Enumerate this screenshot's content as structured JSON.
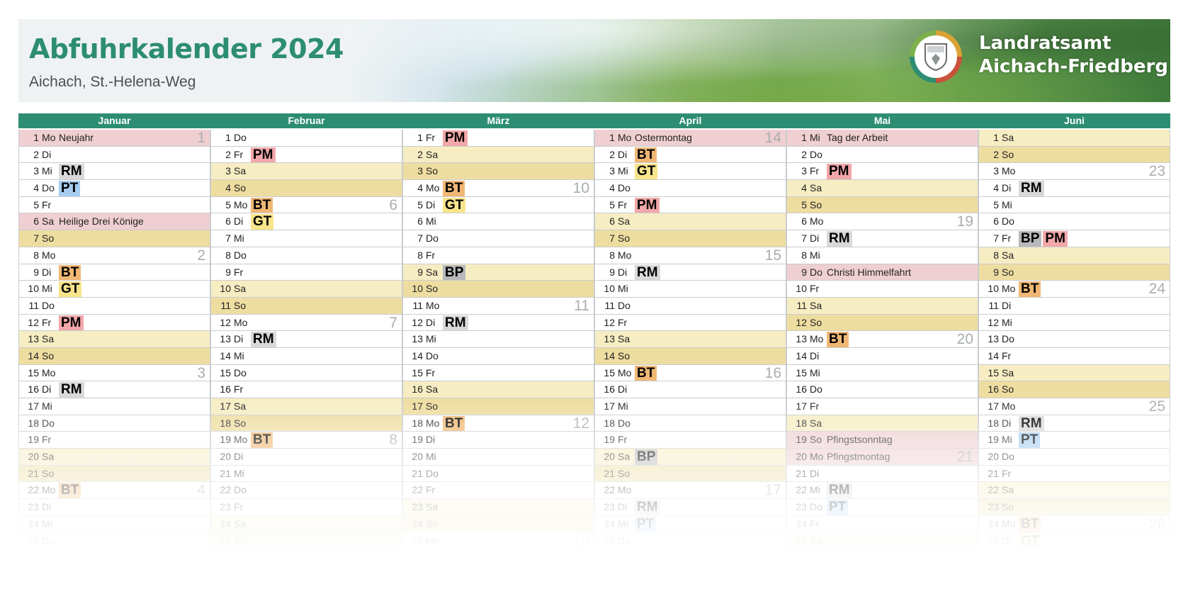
{
  "header": {
    "title": "Abfuhrkalender 2024",
    "subtitle": "Aichach, St.-Helena-Weg",
    "org_line1": "Landratsamt",
    "org_line2": "Aichach-Friedberg",
    "logo_icon": "coat-of-arms-icon"
  },
  "colors": {
    "accent": "#2d8d72",
    "saturday": "#f6edc3",
    "sunday": "#eedda0",
    "holiday": "#efcfd1",
    "RM": "#d9d9d9",
    "PT": "#a6cdf0",
    "PM": "#f2a7a9",
    "BT": "#f0b774",
    "GT": "#f8e48a",
    "BP": "#b7b8ba"
  },
  "months": [
    {
      "name": "Januar",
      "days": [
        {
          "d": "1",
          "wd": "Mo",
          "hol": "Neujahr",
          "kw": "1"
        },
        {
          "d": "2",
          "wd": "Di"
        },
        {
          "d": "3",
          "wd": "Mi",
          "badges": [
            "RM"
          ]
        },
        {
          "d": "4",
          "wd": "Do",
          "badges": [
            "PT"
          ]
        },
        {
          "d": "5",
          "wd": "Fr"
        },
        {
          "d": "6",
          "wd": "Sa",
          "hol": "Heilige Drei Könige"
        },
        {
          "d": "7",
          "wd": "So"
        },
        {
          "d": "8",
          "wd": "Mo",
          "kw": "2"
        },
        {
          "d": "9",
          "wd": "Di",
          "badges": [
            "BT"
          ]
        },
        {
          "d": "10",
          "wd": "Mi",
          "badges": [
            "GT"
          ]
        },
        {
          "d": "11",
          "wd": "Do"
        },
        {
          "d": "12",
          "wd": "Fr",
          "badges": [
            "PM"
          ]
        },
        {
          "d": "13",
          "wd": "Sa"
        },
        {
          "d": "14",
          "wd": "So"
        },
        {
          "d": "15",
          "wd": "Mo",
          "kw": "3"
        },
        {
          "d": "16",
          "wd": "Di",
          "badges": [
            "RM"
          ]
        },
        {
          "d": "17",
          "wd": "Mi"
        },
        {
          "d": "18",
          "wd": "Do"
        },
        {
          "d": "19",
          "wd": "Fr"
        },
        {
          "d": "20",
          "wd": "Sa"
        },
        {
          "d": "21",
          "wd": "So"
        },
        {
          "d": "22",
          "wd": "Mo",
          "badges": [
            "BT"
          ],
          "kw": "4"
        },
        {
          "d": "23",
          "wd": "Di"
        },
        {
          "d": "24",
          "wd": "Mi"
        },
        {
          "d": "25",
          "wd": "Do"
        }
      ]
    },
    {
      "name": "Februar",
      "days": [
        {
          "d": "1",
          "wd": "Do"
        },
        {
          "d": "2",
          "wd": "Fr",
          "badges": [
            "PM"
          ]
        },
        {
          "d": "3",
          "wd": "Sa"
        },
        {
          "d": "4",
          "wd": "So"
        },
        {
          "d": "5",
          "wd": "Mo",
          "badges": [
            "BT"
          ],
          "kw": "6"
        },
        {
          "d": "6",
          "wd": "Di",
          "badges": [
            "GT"
          ]
        },
        {
          "d": "7",
          "wd": "Mi"
        },
        {
          "d": "8",
          "wd": "Do"
        },
        {
          "d": "9",
          "wd": "Fr"
        },
        {
          "d": "10",
          "wd": "Sa"
        },
        {
          "d": "11",
          "wd": "So"
        },
        {
          "d": "12",
          "wd": "Mo",
          "kw": "7"
        },
        {
          "d": "13",
          "wd": "Di",
          "badges": [
            "RM"
          ]
        },
        {
          "d": "14",
          "wd": "Mi"
        },
        {
          "d": "15",
          "wd": "Do"
        },
        {
          "d": "16",
          "wd": "Fr"
        },
        {
          "d": "17",
          "wd": "Sa"
        },
        {
          "d": "18",
          "wd": "So"
        },
        {
          "d": "19",
          "wd": "Mo",
          "badges": [
            "BT"
          ],
          "kw": "8"
        },
        {
          "d": "20",
          "wd": "Di"
        },
        {
          "d": "21",
          "wd": "Mi"
        },
        {
          "d": "22",
          "wd": "Do"
        },
        {
          "d": "23",
          "wd": "Fr"
        },
        {
          "d": "24",
          "wd": "Sa"
        },
        {
          "d": "25",
          "wd": "So"
        }
      ]
    },
    {
      "name": "März",
      "days": [
        {
          "d": "1",
          "wd": "Fr",
          "badges": [
            "PM"
          ]
        },
        {
          "d": "2",
          "wd": "Sa"
        },
        {
          "d": "3",
          "wd": "So"
        },
        {
          "d": "4",
          "wd": "Mo",
          "badges": [
            "BT"
          ],
          "kw": "10"
        },
        {
          "d": "5",
          "wd": "Di",
          "badges": [
            "GT"
          ]
        },
        {
          "d": "6",
          "wd": "Mi"
        },
        {
          "d": "7",
          "wd": "Do"
        },
        {
          "d": "8",
          "wd": "Fr"
        },
        {
          "d": "9",
          "wd": "Sa",
          "badges": [
            "BP"
          ]
        },
        {
          "d": "10",
          "wd": "So"
        },
        {
          "d": "11",
          "wd": "Mo",
          "kw": "11"
        },
        {
          "d": "12",
          "wd": "Di",
          "badges": [
            "RM"
          ]
        },
        {
          "d": "13",
          "wd": "Mi"
        },
        {
          "d": "14",
          "wd": "Do"
        },
        {
          "d": "15",
          "wd": "Fr"
        },
        {
          "d": "16",
          "wd": "Sa"
        },
        {
          "d": "17",
          "wd": "So"
        },
        {
          "d": "18",
          "wd": "Mo",
          "badges": [
            "BT"
          ],
          "kw": "12"
        },
        {
          "d": "19",
          "wd": "Di"
        },
        {
          "d": "20",
          "wd": "Mi"
        },
        {
          "d": "21",
          "wd": "Do"
        },
        {
          "d": "22",
          "wd": "Fr"
        },
        {
          "d": "23",
          "wd": "Sa"
        },
        {
          "d": "24",
          "wd": "So"
        },
        {
          "d": "25",
          "wd": "Mo",
          "kw": "13"
        }
      ]
    },
    {
      "name": "April",
      "days": [
        {
          "d": "1",
          "wd": "Mo",
          "hol": "Ostermontag",
          "kw": "14"
        },
        {
          "d": "2",
          "wd": "Di",
          "badges": [
            "BT"
          ]
        },
        {
          "d": "3",
          "wd": "Mi",
          "badges": [
            "GT"
          ]
        },
        {
          "d": "4",
          "wd": "Do"
        },
        {
          "d": "5",
          "wd": "Fr",
          "badges": [
            "PM"
          ]
        },
        {
          "d": "6",
          "wd": "Sa"
        },
        {
          "d": "7",
          "wd": "So"
        },
        {
          "d": "8",
          "wd": "Mo",
          "kw": "15"
        },
        {
          "d": "9",
          "wd": "Di",
          "badges": [
            "RM"
          ]
        },
        {
          "d": "10",
          "wd": "Mi"
        },
        {
          "d": "11",
          "wd": "Do"
        },
        {
          "d": "12",
          "wd": "Fr"
        },
        {
          "d": "13",
          "wd": "Sa"
        },
        {
          "d": "14",
          "wd": "So"
        },
        {
          "d": "15",
          "wd": "Mo",
          "badges": [
            "BT"
          ],
          "kw": "16"
        },
        {
          "d": "16",
          "wd": "Di"
        },
        {
          "d": "17",
          "wd": "Mi"
        },
        {
          "d": "18",
          "wd": "Do"
        },
        {
          "d": "19",
          "wd": "Fr"
        },
        {
          "d": "20",
          "wd": "Sa",
          "badges": [
            "BP"
          ]
        },
        {
          "d": "21",
          "wd": "So"
        },
        {
          "d": "22",
          "wd": "Mo",
          "kw": "17"
        },
        {
          "d": "23",
          "wd": "Di",
          "badges": [
            "RM"
          ]
        },
        {
          "d": "24",
          "wd": "Mi",
          "badges": [
            "PT"
          ]
        },
        {
          "d": "25",
          "wd": "Do"
        }
      ]
    },
    {
      "name": "Mai",
      "days": [
        {
          "d": "1",
          "wd": "Mi",
          "hol": "Tag der Arbeit"
        },
        {
          "d": "2",
          "wd": "Do"
        },
        {
          "d": "3",
          "wd": "Fr",
          "badges": [
            "PM"
          ]
        },
        {
          "d": "4",
          "wd": "Sa"
        },
        {
          "d": "5",
          "wd": "So"
        },
        {
          "d": "6",
          "wd": "Mo",
          "kw": "19"
        },
        {
          "d": "7",
          "wd": "Di",
          "badges": [
            "RM"
          ]
        },
        {
          "d": "8",
          "wd": "Mi"
        },
        {
          "d": "9",
          "wd": "Do",
          "hol": "Christi Himmelfahrt"
        },
        {
          "d": "10",
          "wd": "Fr"
        },
        {
          "d": "11",
          "wd": "Sa"
        },
        {
          "d": "12",
          "wd": "So"
        },
        {
          "d": "13",
          "wd": "Mo",
          "badges": [
            "BT"
          ],
          "kw": "20"
        },
        {
          "d": "14",
          "wd": "Di"
        },
        {
          "d": "15",
          "wd": "Mi"
        },
        {
          "d": "16",
          "wd": "Do"
        },
        {
          "d": "17",
          "wd": "Fr"
        },
        {
          "d": "18",
          "wd": "Sa"
        },
        {
          "d": "19",
          "wd": "So",
          "hol": "Pfingstsonntag"
        },
        {
          "d": "20",
          "wd": "Mo",
          "hol": "Pfingstmontag",
          "kw": "21"
        },
        {
          "d": "21",
          "wd": "Di"
        },
        {
          "d": "22",
          "wd": "Mi",
          "badges": [
            "RM"
          ]
        },
        {
          "d": "23",
          "wd": "Do",
          "badges": [
            "PT"
          ]
        },
        {
          "d": "24",
          "wd": "Fr"
        },
        {
          "d": "25",
          "wd": "Sa"
        }
      ]
    },
    {
      "name": "Juni",
      "days": [
        {
          "d": "1",
          "wd": "Sa"
        },
        {
          "d": "2",
          "wd": "So"
        },
        {
          "d": "3",
          "wd": "Mo",
          "kw": "23"
        },
        {
          "d": "4",
          "wd": "Di",
          "badges": [
            "RM"
          ]
        },
        {
          "d": "5",
          "wd": "Mi"
        },
        {
          "d": "6",
          "wd": "Do"
        },
        {
          "d": "7",
          "wd": "Fr",
          "badges": [
            "BP",
            "PM"
          ]
        },
        {
          "d": "8",
          "wd": "Sa"
        },
        {
          "d": "9",
          "wd": "So"
        },
        {
          "d": "10",
          "wd": "Mo",
          "badges": [
            "BT"
          ],
          "kw": "24"
        },
        {
          "d": "11",
          "wd": "Di"
        },
        {
          "d": "12",
          "wd": "Mi"
        },
        {
          "d": "13",
          "wd": "Do"
        },
        {
          "d": "14",
          "wd": "Fr"
        },
        {
          "d": "15",
          "wd": "Sa"
        },
        {
          "d": "16",
          "wd": "So"
        },
        {
          "d": "17",
          "wd": "Mo",
          "kw": "25"
        },
        {
          "d": "18",
          "wd": "Di",
          "badges": [
            "RM"
          ]
        },
        {
          "d": "19",
          "wd": "Mi",
          "badges": [
            "PT"
          ]
        },
        {
          "d": "20",
          "wd": "Do"
        },
        {
          "d": "21",
          "wd": "Fr"
        },
        {
          "d": "22",
          "wd": "Sa"
        },
        {
          "d": "23",
          "wd": "So"
        },
        {
          "d": "24",
          "wd": "Mo",
          "badges": [
            "BT"
          ],
          "kw": "26"
        },
        {
          "d": "25",
          "wd": "Di",
          "badges": [
            "GT"
          ]
        }
      ]
    }
  ]
}
